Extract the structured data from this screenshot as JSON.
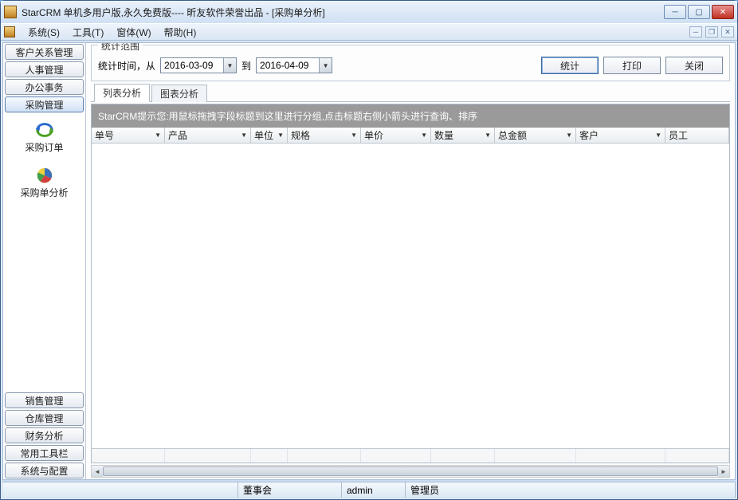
{
  "window": {
    "title": "StarCRM 单机多用户版,永久免费版---- 昕友软件荣誉出品  - [采购单分析]"
  },
  "menu": {
    "system": "系统(S)",
    "tools": "工具(T)",
    "window": "窗体(W)",
    "help": "帮助(H)"
  },
  "sidebar": {
    "groups": {
      "customer": "客户关系管理",
      "hr": "人事管理",
      "office": "办公事务",
      "purchase": "采购管理",
      "sales": "销售管理",
      "warehouse": "仓库管理",
      "finance": "财务分析",
      "toolbar": "常用工具栏",
      "config": "系统与配置"
    },
    "items": {
      "purchase_order": "采购订单",
      "purchase_analysis": "采购单分析"
    }
  },
  "filter": {
    "legend": "统计范围",
    "time_label": "统计时间，从",
    "date_from": "2016-03-09",
    "to_label": "到",
    "date_to": "2016-04-09",
    "btn_stat": "统计",
    "btn_print": "打印",
    "btn_close": "关闭"
  },
  "tabs": {
    "list": "列表分析",
    "chart": "图表分析"
  },
  "grid": {
    "hint": "StarCRM提示您:用鼠标拖拽字段标题到这里进行分组,点击标题右侧小箭头进行查询、排序",
    "cols": {
      "c1": "单号",
      "c2": "产品",
      "c3": "单位",
      "c4": "规格",
      "c5": "单价",
      "c6": "数量",
      "c7": "总金额",
      "c8": "客户",
      "c9": "员工"
    }
  },
  "status": {
    "s1": "董事会",
    "s2": "admin",
    "s3": "管理员"
  }
}
